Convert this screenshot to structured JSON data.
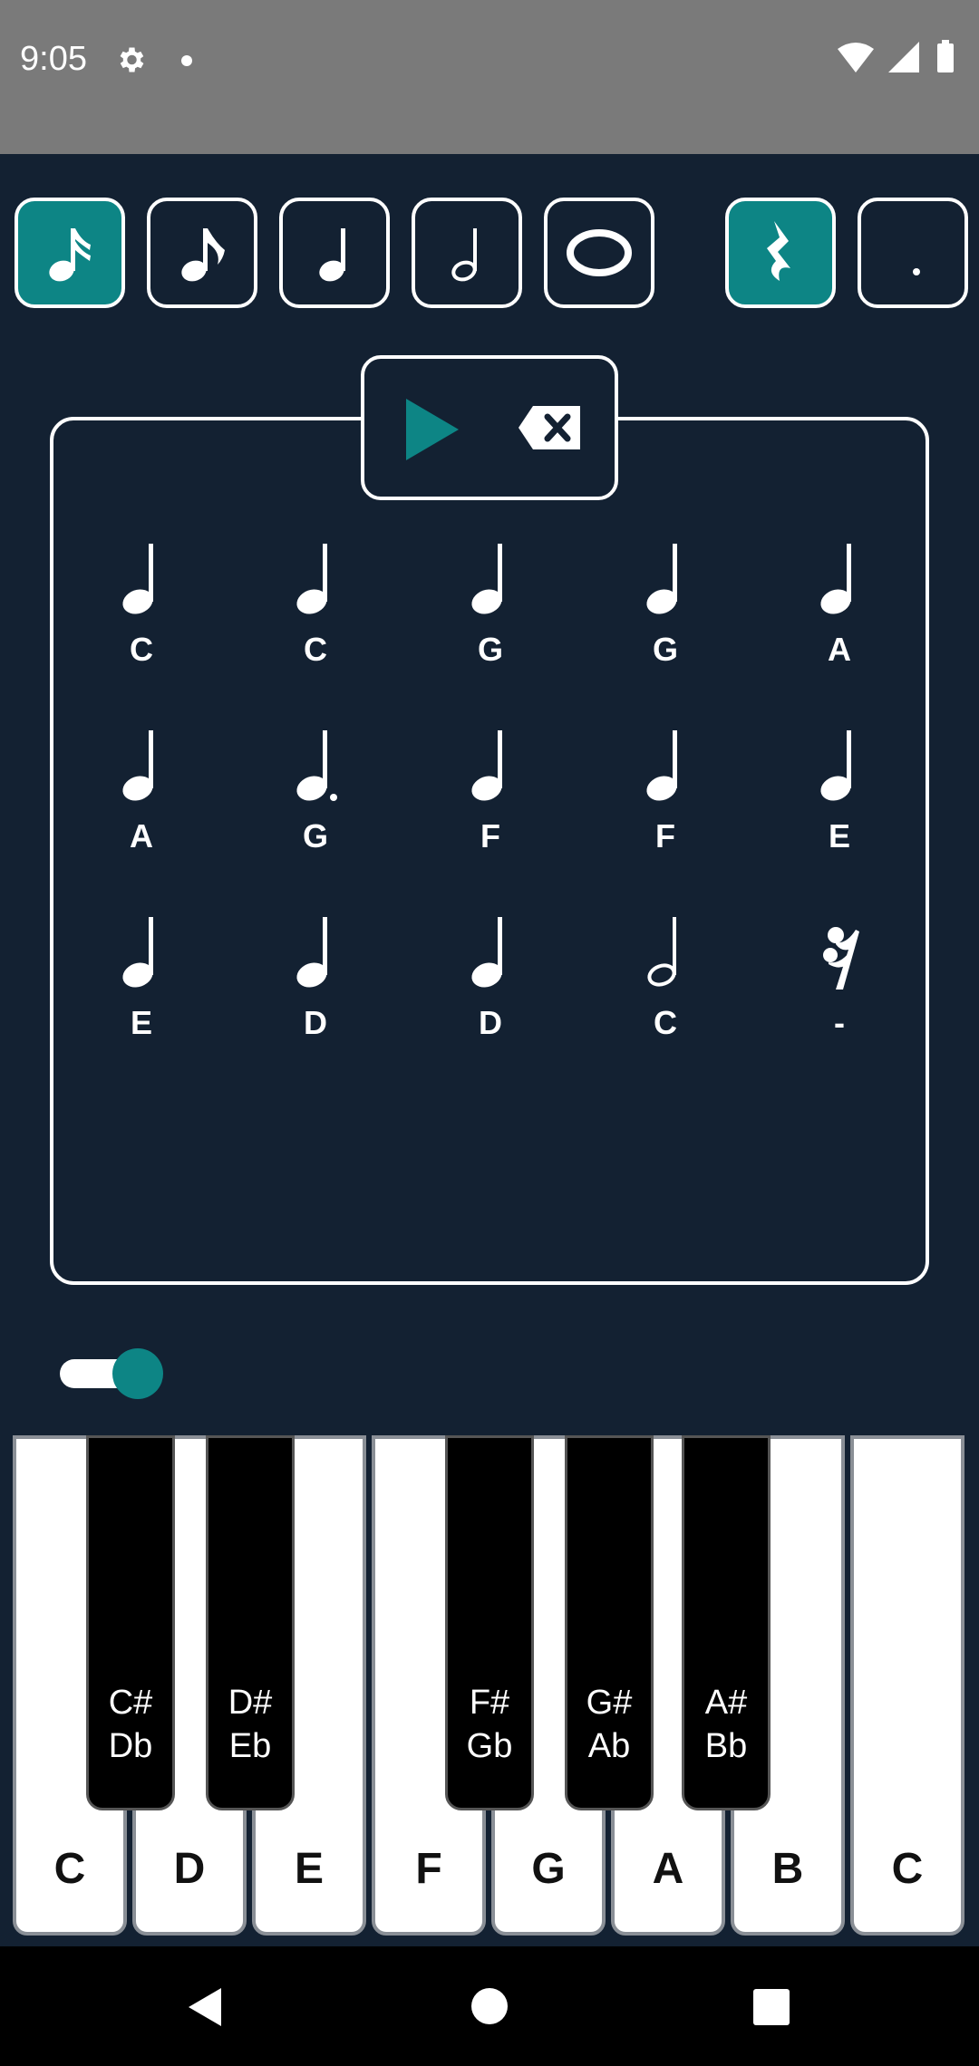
{
  "status": {
    "time": "9:05"
  },
  "toolbar": {
    "buttons": [
      {
        "icon": "sixteenth-note-icon",
        "active": true
      },
      {
        "icon": "eighth-note-icon",
        "active": false
      },
      {
        "icon": "quarter-note-icon",
        "active": false
      },
      {
        "icon": "half-note-icon",
        "active": false
      },
      {
        "icon": "whole-note-icon",
        "active": false
      },
      {
        "icon": "rest-icon",
        "active": true
      },
      {
        "icon": "dot-icon",
        "active": false
      }
    ]
  },
  "controls": {
    "play_icon": "play-icon",
    "delete_icon": "backspace-icon"
  },
  "colors": {
    "accent": "#0d8585",
    "background": "#132132",
    "statusbar": "#7a7a7a"
  },
  "notes": [
    {
      "label": "C",
      "type": "quarter"
    },
    {
      "label": "C",
      "type": "quarter"
    },
    {
      "label": "G",
      "type": "quarter"
    },
    {
      "label": "G",
      "type": "quarter"
    },
    {
      "label": "A",
      "type": "quarter"
    },
    {
      "label": "A",
      "type": "quarter"
    },
    {
      "label": "G",
      "type": "dotted-quarter"
    },
    {
      "label": "F",
      "type": "quarter"
    },
    {
      "label": "F",
      "type": "quarter"
    },
    {
      "label": "E",
      "type": "quarter"
    },
    {
      "label": "E",
      "type": "quarter"
    },
    {
      "label": "D",
      "type": "quarter"
    },
    {
      "label": "D",
      "type": "quarter"
    },
    {
      "label": "C",
      "type": "half"
    },
    {
      "label": "-",
      "type": "rest"
    }
  ],
  "toggle": {
    "on": true
  },
  "piano": {
    "white_keys": [
      "C",
      "D",
      "E",
      "F",
      "G",
      "A",
      "B",
      "C"
    ],
    "black_keys": [
      {
        "sharp": "C#",
        "flat": "Db"
      },
      {
        "sharp": "D#",
        "flat": "Eb"
      },
      {
        "sharp": "F#",
        "flat": "Gb"
      },
      {
        "sharp": "G#",
        "flat": "Ab"
      },
      {
        "sharp": "A#",
        "flat": "Bb"
      }
    ]
  }
}
